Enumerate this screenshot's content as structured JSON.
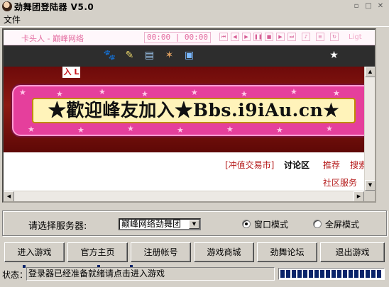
{
  "window": {
    "title": "劲舞团登陆器  V5.0",
    "controls": [
      "min",
      "max",
      "close"
    ]
  },
  "menu": {
    "file": "文件"
  },
  "player": {
    "song": "卡头人 - 巅峰网络",
    "time": "00:00 | 00:00",
    "light": "Ligt"
  },
  "navbar": {
    "icons": [
      "paw-icon",
      "pencil-icon",
      "window-icon",
      "dancer-icon",
      "film-icon",
      "star-icon"
    ]
  },
  "banner": {
    "small_ad": "入 L",
    "welcome": "★歡迎峰友加入★Bbs.i9iAu.cn★"
  },
  "site_links": {
    "recharge": "[冲值交易市]",
    "forum": "讨论区",
    "recommend": "推荐",
    "search": "搜索",
    "community": "社区服务"
  },
  "server": {
    "label": "请选择服务器:",
    "selected": "巅峰网络劲舞团",
    "window_mode": "窗口模式",
    "fullscreen_mode": "全屏模式",
    "mode": "window"
  },
  "buttons": {
    "enter_game": "进入游戏",
    "official_home": "官方主页",
    "register": "注册帐号",
    "shop": "游戏商城",
    "forum": "劲舞论坛",
    "exit": "退出游戏"
  },
  "status": {
    "label": "状态：",
    "text": "登录器已经准备就绪请点击进入游戏",
    "progress": 1.0
  },
  "colors": {
    "accent": "#0a246a",
    "banner_pink": "#e53f9c",
    "link_red": "#b41818"
  }
}
